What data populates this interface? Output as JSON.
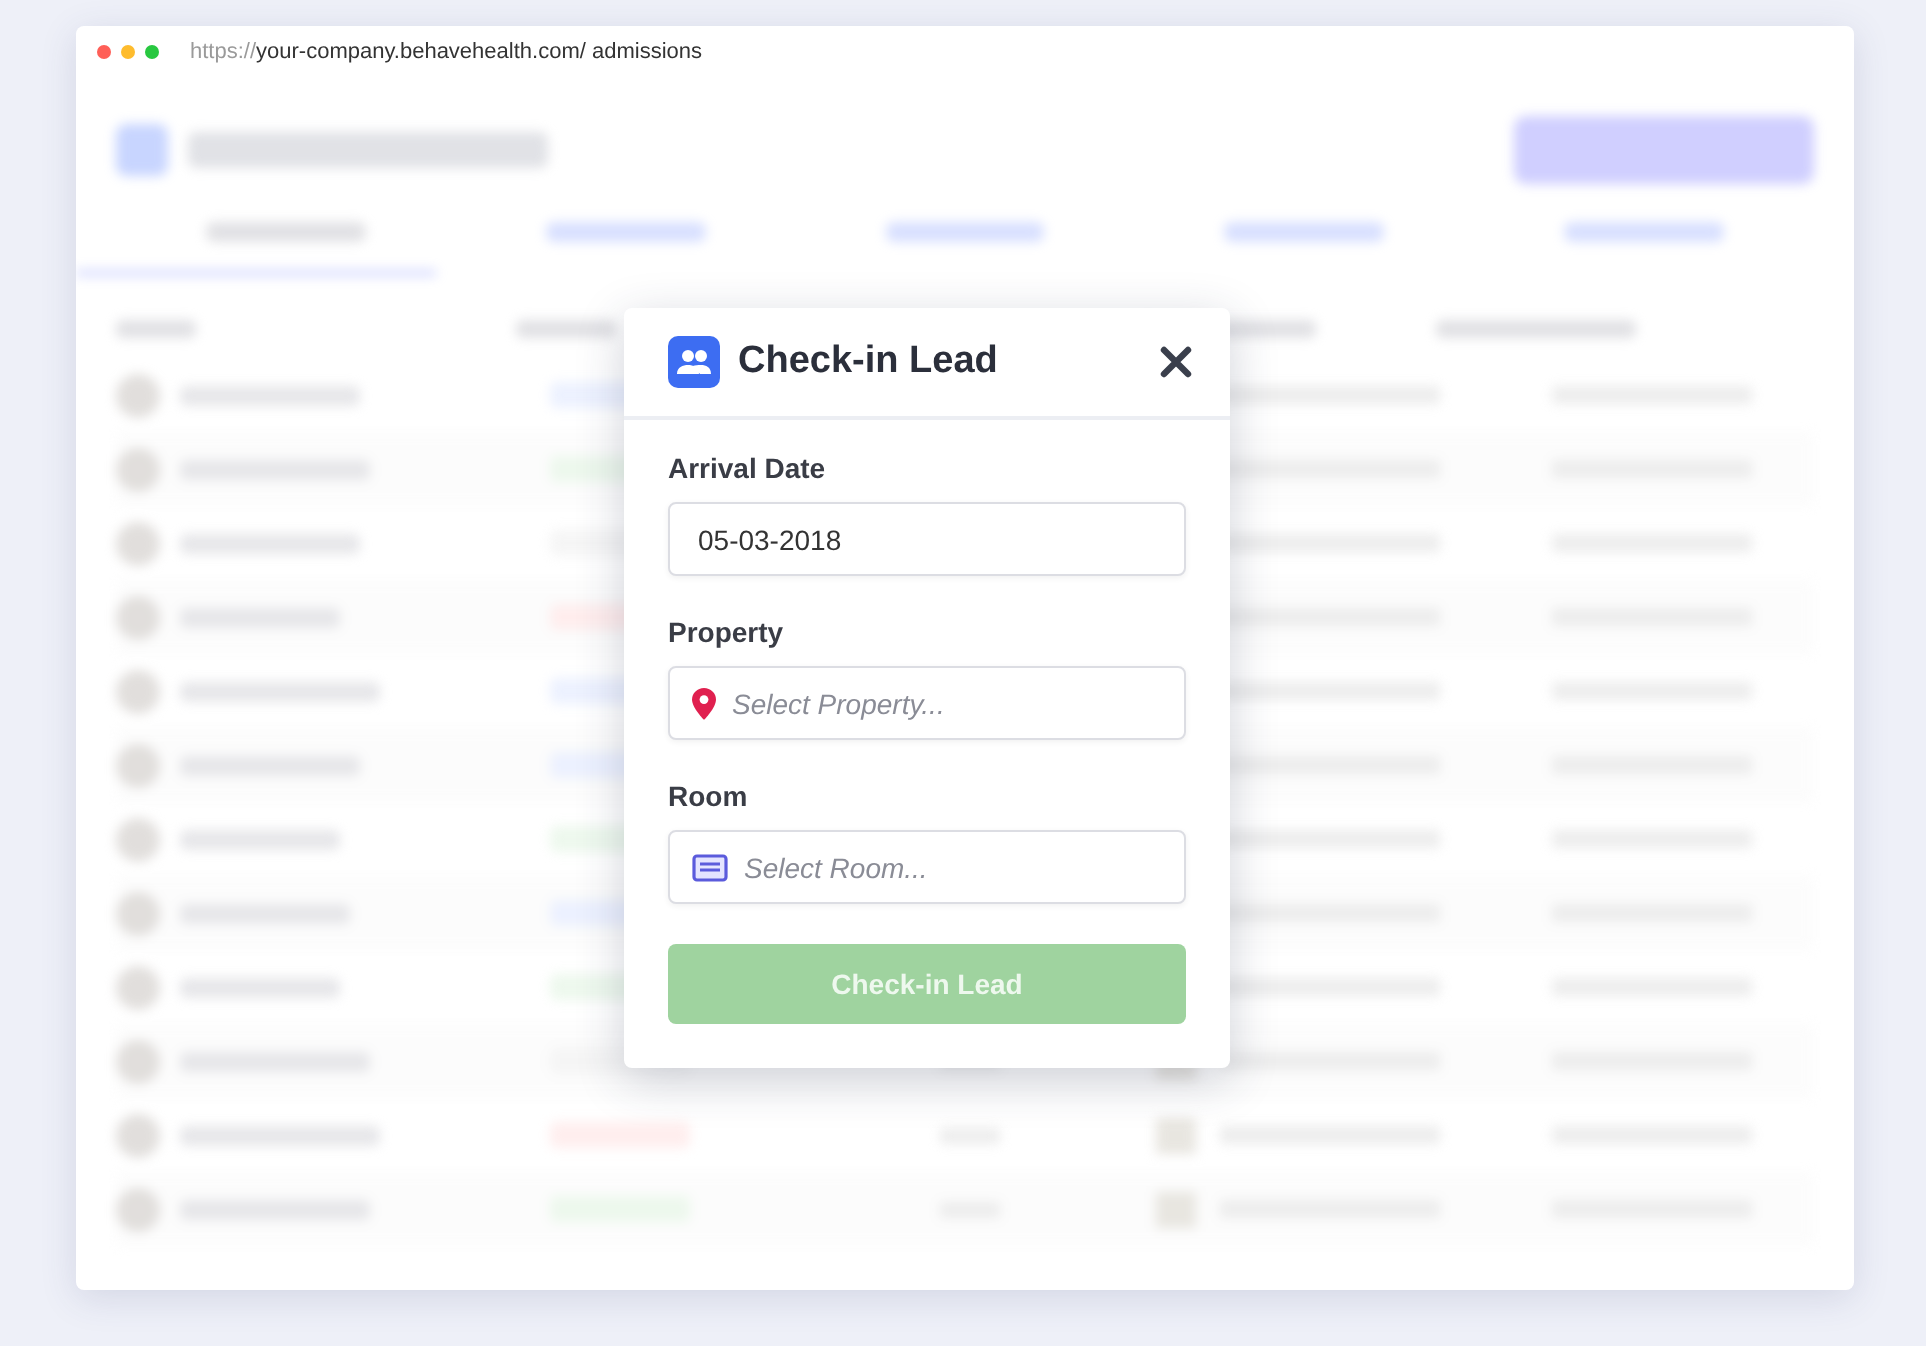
{
  "browser": {
    "url_scheme": "https://",
    "url_rest": "your-company.behavehealth.com/ admissions"
  },
  "dialog": {
    "title": "Check-in Lead",
    "fields": [
      {
        "kind": "date",
        "label": "Arrival Date",
        "value": "05-03-2018"
      },
      {
        "kind": "property",
        "label": "Property",
        "placeholder": "Select Property..."
      },
      {
        "kind": "room",
        "label": "Room",
        "placeholder": "Select Room..."
      }
    ],
    "submit": {
      "label": "Check-in Lead",
      "disabled": true
    }
  }
}
